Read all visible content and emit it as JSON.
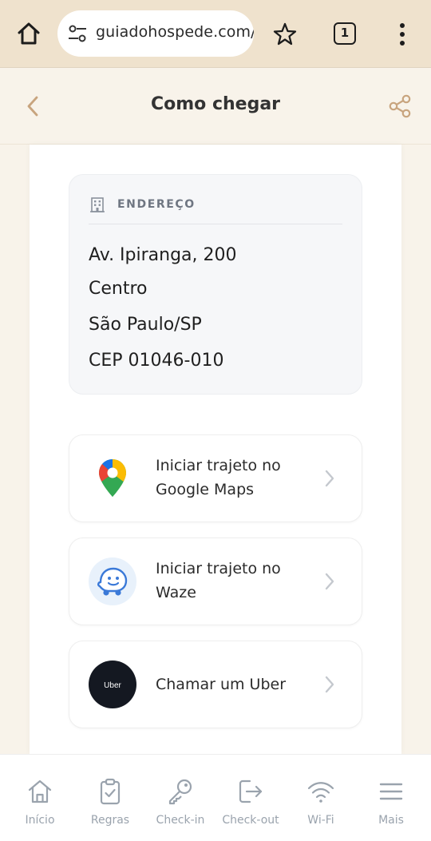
{
  "browser": {
    "url": "guiadohospede.com/p",
    "tab_count": "1"
  },
  "header": {
    "title": "Como chegar"
  },
  "address": {
    "label": "ENDEREÇO",
    "line1": "Av. Ipiranga, 200",
    "line2": "Centro",
    "line3": "São Paulo/SP",
    "line4": "CEP 01046-010"
  },
  "actions": [
    {
      "label": "Iniciar trajeto no Google Maps",
      "icon": "google-maps-icon"
    },
    {
      "label": "Iniciar trajeto no Waze",
      "icon": "waze-icon"
    },
    {
      "label": "Chamar um Uber",
      "icon": "uber-icon",
      "icon_text": "Uber"
    }
  ],
  "nav": [
    {
      "label": "Início",
      "icon": "home-icon"
    },
    {
      "label": "Regras",
      "icon": "clipboard-check-icon"
    },
    {
      "label": "Check-in",
      "icon": "key-icon"
    },
    {
      "label": "Check-out",
      "icon": "logout-icon"
    },
    {
      "label": "Wi-Fi",
      "icon": "wifi-icon"
    },
    {
      "label": "Mais",
      "icon": "menu-icon"
    }
  ],
  "colors": {
    "chrome_bg": "#efe2cd",
    "page_bg": "#f8f3ea",
    "accent": "#c8a47e",
    "nav_inactive": "#9aa3ad"
  }
}
